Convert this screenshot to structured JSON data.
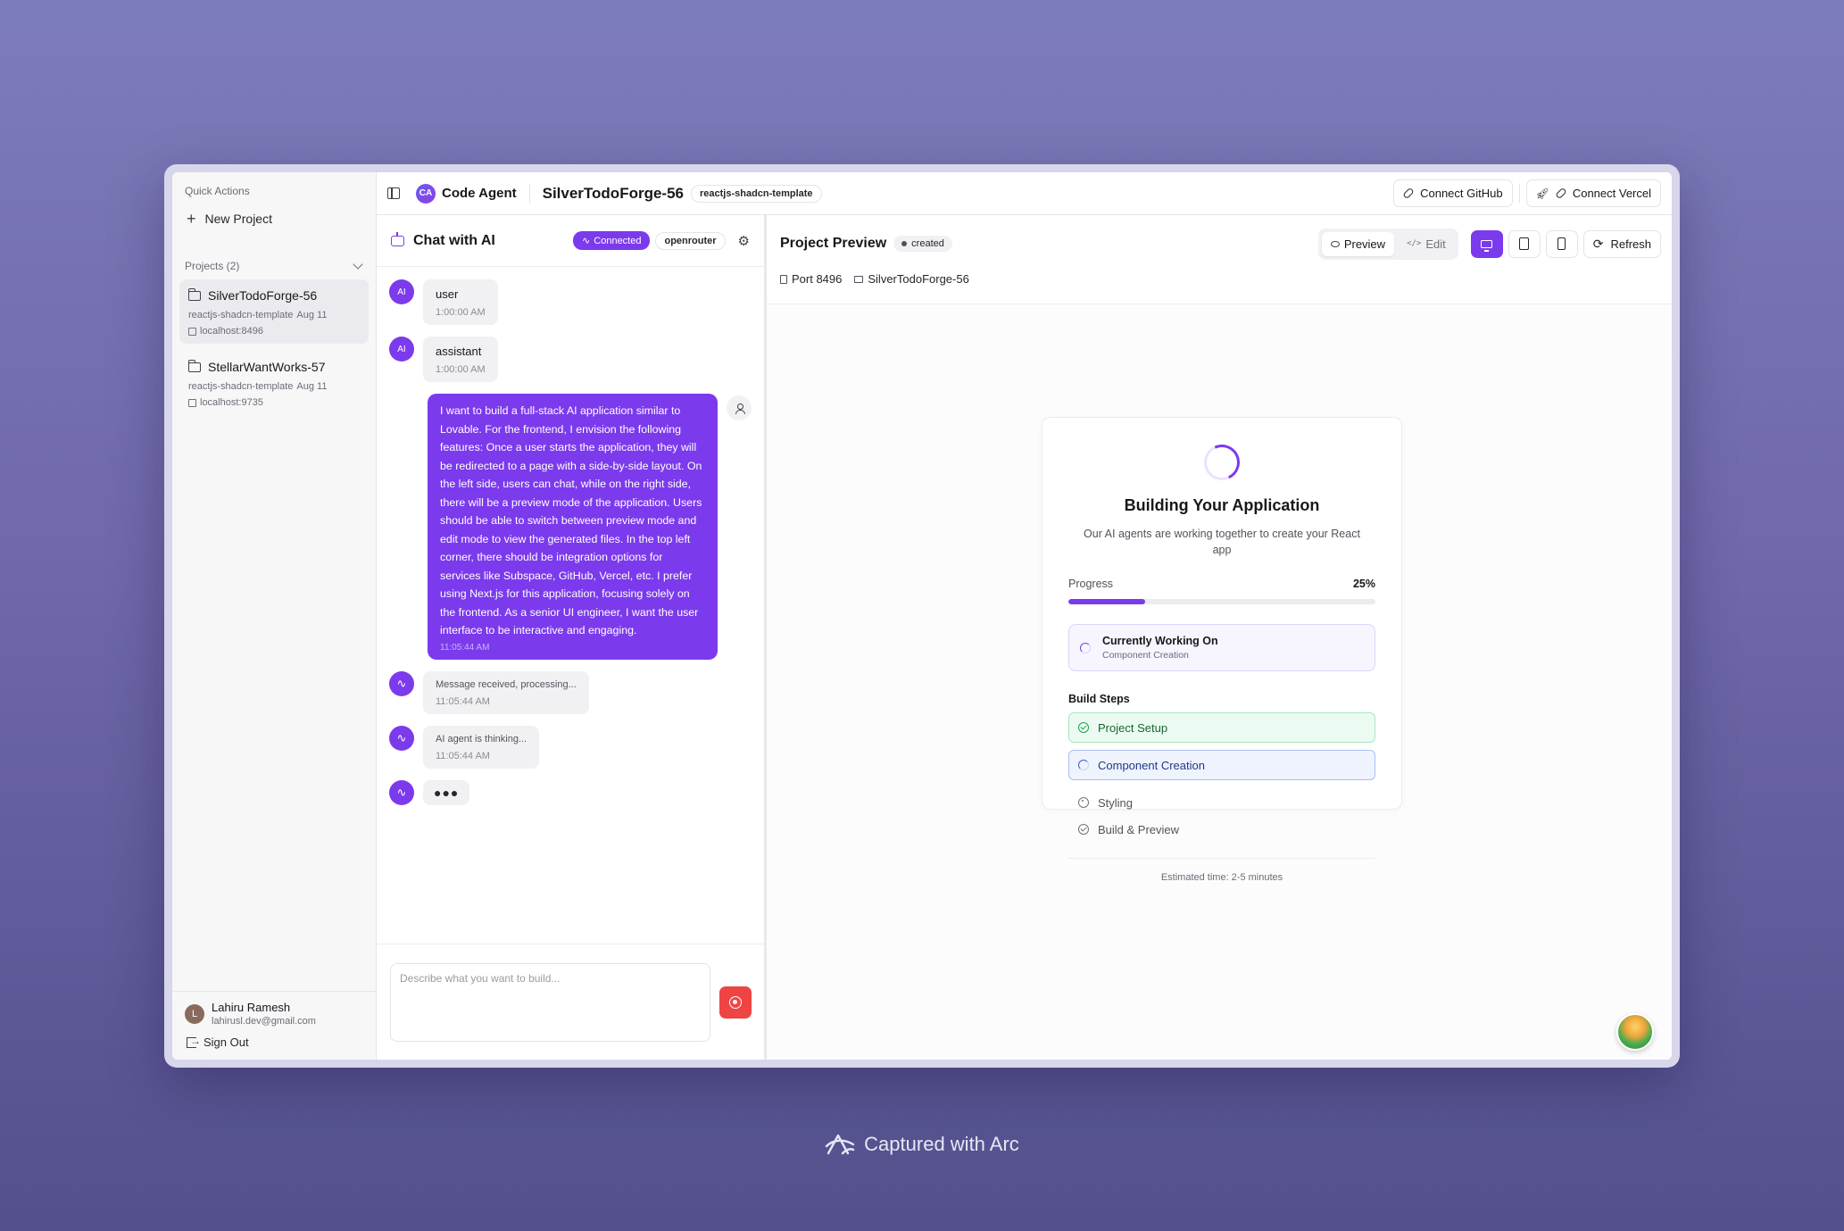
{
  "sidebar": {
    "quick_actions_title": "Quick Actions",
    "new_project_label": "New Project",
    "projects_header": "Projects (2)",
    "projects": [
      {
        "name": "SilverTodoForge-56",
        "template": "reactjs-shadcn-template",
        "date": "Aug 11",
        "host": "localhost:8496",
        "active": true
      },
      {
        "name": "StellarWantWorks-57",
        "template": "reactjs-shadcn-template",
        "date": "Aug 11",
        "host": "localhost:9735",
        "active": false
      }
    ],
    "user": {
      "initial": "L",
      "name": "Lahiru Ramesh",
      "email": "lahirusl.dev@gmail.com"
    },
    "sign_out_label": "Sign Out"
  },
  "topbar": {
    "logo_text": "CA",
    "brand": "Code Agent",
    "project_title": "SilverTodoForge-56",
    "template_badge": "reactjs-shadcn-template",
    "connect_github": "Connect GitHub",
    "connect_vercel": "Connect Vercel"
  },
  "chat": {
    "title": "Chat with AI",
    "status_badge": "Connected",
    "model_badge": "openrouter",
    "messages": [
      {
        "role": "ai",
        "avatar": "AI",
        "text": "user",
        "time": "1:00:00 AM"
      },
      {
        "role": "ai",
        "avatar": "AI",
        "text": "assistant",
        "time": "1:00:00 AM"
      },
      {
        "role": "user",
        "text": "I want to build a full-stack AI application similar to Lovable. For the frontend, I envision the following features: Once a user starts the application, they will be redirected to a page with a side-by-side layout. On the left side, users can chat, while on the right side, there will be a preview mode of the application. Users should be able to switch between preview mode and edit mode to view the generated files. In the top left corner, there should be integration options for services like Subspace, GitHub, Vercel, etc. I prefer using Next.js for this application, focusing solely on the frontend. As a senior UI engineer, I want the user interface to be interactive and engaging.",
        "time": "11:05:44 AM"
      },
      {
        "role": "system",
        "text": "Message received, processing...",
        "time": "11:05:44 AM"
      },
      {
        "role": "system",
        "text": "AI agent is thinking...",
        "time": "11:05:44 AM"
      }
    ],
    "typing_dots": "●●●",
    "input_placeholder": "Describe what you want to build..."
  },
  "preview": {
    "title": "Project Preview",
    "status_badge": "created",
    "tab_preview": "Preview",
    "tab_edit": "Edit",
    "refresh_label": "Refresh",
    "port_label": "Port 8496",
    "folder_label": "SilverTodoForge-56",
    "card": {
      "title": "Building Your Application",
      "subtitle": "Our AI agents are working together to create your React app",
      "progress_label": "Progress",
      "progress_percent": 25,
      "progress_text": "25%",
      "working_title": "Currently Working On",
      "working_step": "Component Creation",
      "steps_title": "Build Steps",
      "steps": [
        {
          "label": "Project Setup",
          "status": "done"
        },
        {
          "label": "Component Creation",
          "status": "current"
        },
        {
          "label": "Styling",
          "status": "pending"
        },
        {
          "label": "Build & Preview",
          "status": "pending"
        }
      ],
      "footer": "Estimated time: 2-5 minutes"
    }
  },
  "caption": "Captured with Arc",
  "colors": {
    "accent": "#7c3aed",
    "send": "#ef4444",
    "success": "#16a34a"
  }
}
